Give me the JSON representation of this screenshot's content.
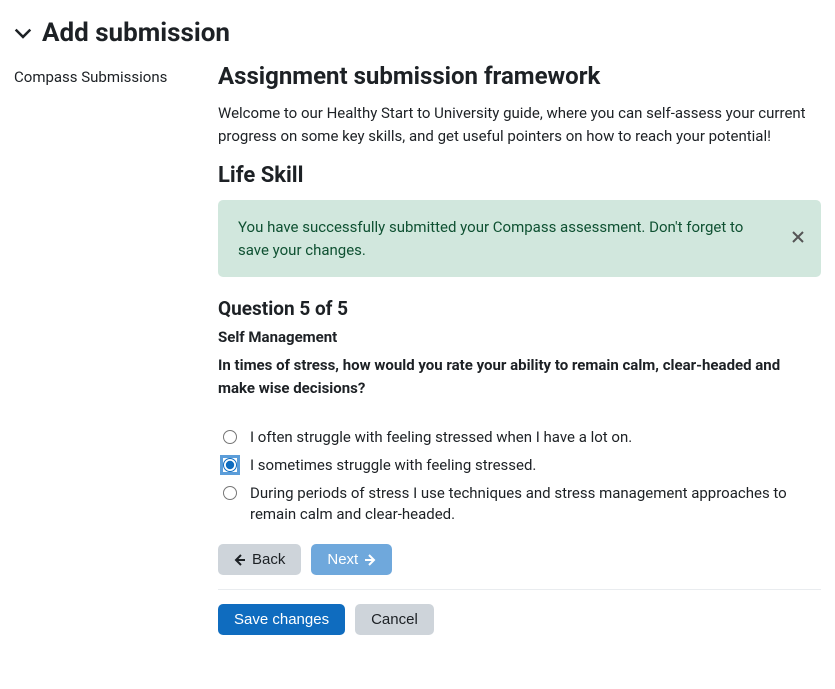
{
  "header": {
    "title": "Add submission"
  },
  "sidebar": {
    "link": "Compass Submissions"
  },
  "main": {
    "heading": "Assignment submission framework",
    "intro": "Welcome to our Healthy Start to University guide, where you can self-assess your current progress on some key skills, and get useful pointers on how to reach your potential!",
    "life_skill_heading": "Life Skill",
    "alert_text": "You have successfully submitted your Compass assessment. Don't forget to save your changes.",
    "question": {
      "number_label": "Question 5 of 5",
      "category": "Self Management",
      "text": "In times of stress, how would you rate your ability to remain calm, clear-headed and make wise decisions?",
      "options": [
        "I often struggle with feeling stressed when I have a lot on.",
        "I sometimes struggle with feeling stressed.",
        "During periods of stress I use techniques and stress management approaches to remain calm and clear-headed."
      ],
      "selected_index": 1
    },
    "buttons": {
      "back": "Back",
      "next": "Next",
      "save": "Save changes",
      "cancel": "Cancel"
    }
  }
}
